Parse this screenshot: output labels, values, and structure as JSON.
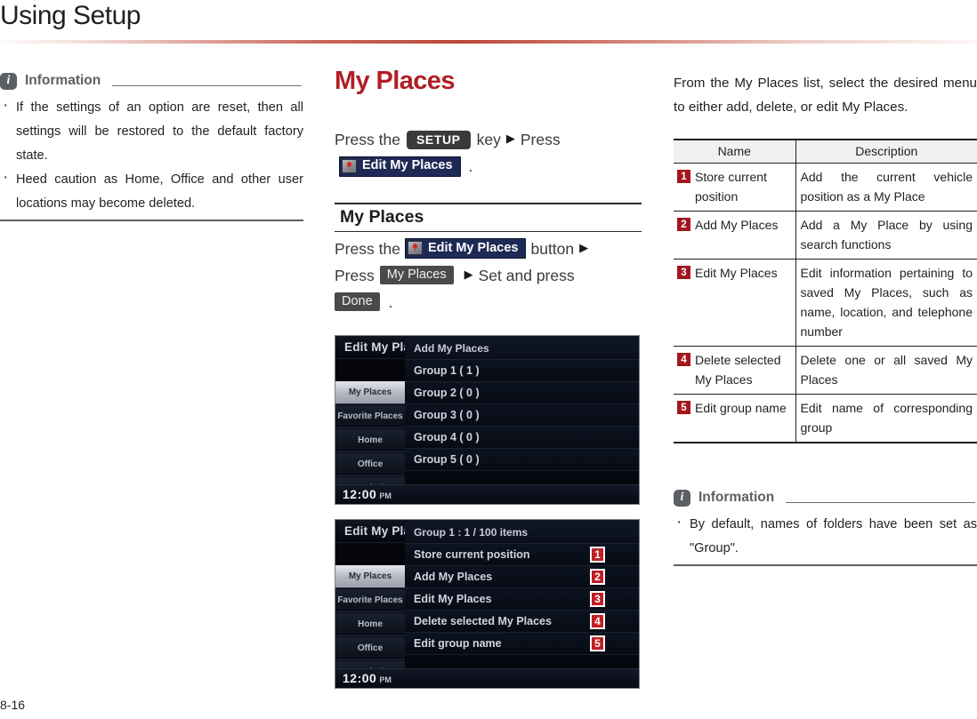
{
  "header": {
    "title": "Using Setup"
  },
  "footer": {
    "page_number": "8-16"
  },
  "left": {
    "info": {
      "icon": "information-icon",
      "label": "Information",
      "items": [
        "If the settings of an option are reset, then all settings will be restored to the default factory state.",
        "Heed caution as Home, Office and other user locations may become deleted."
      ]
    }
  },
  "middle": {
    "section_title": "My Places",
    "intro": {
      "press_the": "Press the",
      "setup_key": "SETUP",
      "key_word": "key",
      "arrow": "▶",
      "press": "Press",
      "edit_my_places": "Edit My Places",
      "period": "."
    },
    "subsection": {
      "heading": "My Places",
      "press_the": "Press the",
      "edit_my_places": "Edit My Places",
      "button_word": "button",
      "arrow": "▶",
      "press": "Press",
      "my_places": "My Places",
      "set_and_press": "Set and press",
      "done": "Done",
      "period": "."
    },
    "screenshot_1": {
      "title": "Edit My Places",
      "back_icon": "return-arrow-icon",
      "subheader": "Add My Places",
      "sidebar": [
        "My Places",
        "Favorite Places",
        "Home",
        "Office",
        "Speed Alert"
      ],
      "rows": [
        {
          "label": "Group 1 ( 1 )"
        },
        {
          "label": "Group 2 ( 0 )"
        },
        {
          "label": "Group 3 ( 0 )"
        },
        {
          "label": "Group 4 ( 0 )"
        },
        {
          "label": "Group 5 ( 0 )"
        }
      ],
      "clock": {
        "time": "12:00",
        "meridiem": "PM"
      }
    },
    "screenshot_2": {
      "title": "Edit My Places",
      "back_icon": "return-arrow-icon",
      "subheader": "Group 1 : 1 / 100 items",
      "sidebar": [
        "My Places",
        "Favorite Places",
        "Home",
        "Office",
        "Speed Alert"
      ],
      "rows": [
        {
          "label": "Store current position",
          "num": "1"
        },
        {
          "label": "Add My Places",
          "num": "2"
        },
        {
          "label": "Edit My Places",
          "num": "3"
        },
        {
          "label": "Delete selected My Places",
          "num": "4"
        },
        {
          "label": "Edit group name",
          "num": "5"
        }
      ],
      "clock": {
        "time": "12:00",
        "meridiem": "PM"
      }
    }
  },
  "right": {
    "lead": "From the My Places list, select the desired menu to either add, delete, or edit My Places.",
    "table": {
      "columns": [
        "Name",
        "Description"
      ],
      "rows": [
        {
          "num": "1",
          "name": "Store current position",
          "description": "Add the current vehicle position as a My Place"
        },
        {
          "num": "2",
          "name": "Add My Places",
          "description": "Add a My Place by using search functions"
        },
        {
          "num": "3",
          "name": "Edit My Places",
          "description": "Edit information pertaining to saved My Places, such as name, location, and telephone number"
        },
        {
          "num": "4",
          "name": "Delete selected My Places",
          "description": "Delete one or all saved My Places"
        },
        {
          "num": "5",
          "name": "Edit group name",
          "description": "Edit name of corresponding group"
        }
      ]
    },
    "info": {
      "icon": "information-icon",
      "label": "Information",
      "items": [
        "By default, names of folders have been set as \"Group\"."
      ]
    }
  },
  "colors": {
    "accent_red": "#b01f24",
    "badge_red": "#a4161e",
    "info_gray": "#5c5f63",
    "nav_blue": "#1e2a55"
  }
}
